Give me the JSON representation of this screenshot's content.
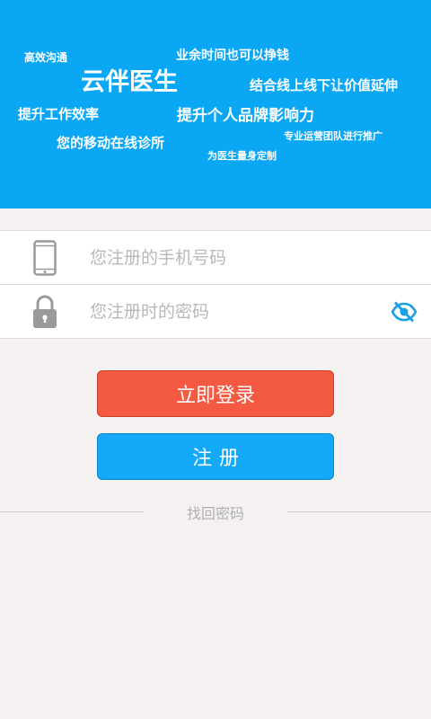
{
  "banner": {
    "bg_color": "#0aa8f4",
    "app_name": "云伴医生",
    "slogans": [
      "高效沟通",
      "业余时间也可以挣钱",
      "结合线上线下让价值延伸",
      "提升工作效率",
      "提升个人品牌影响力",
      "您的移动在线诊所",
      "专业运营团队进行推广",
      "为医生量身定制"
    ]
  },
  "form": {
    "phone_icon": "phone-icon",
    "phone_placeholder": "您注册的手机号码",
    "password_icon": "lock-icon",
    "password_placeholder": "您注册时的密码",
    "toggle_icon": "eye-off-icon"
  },
  "actions": {
    "login_label": "立即登录",
    "login_color": "#f45a42",
    "register_label": "注册",
    "register_color": "#14a9f8",
    "forgot_label": "找回密码"
  }
}
